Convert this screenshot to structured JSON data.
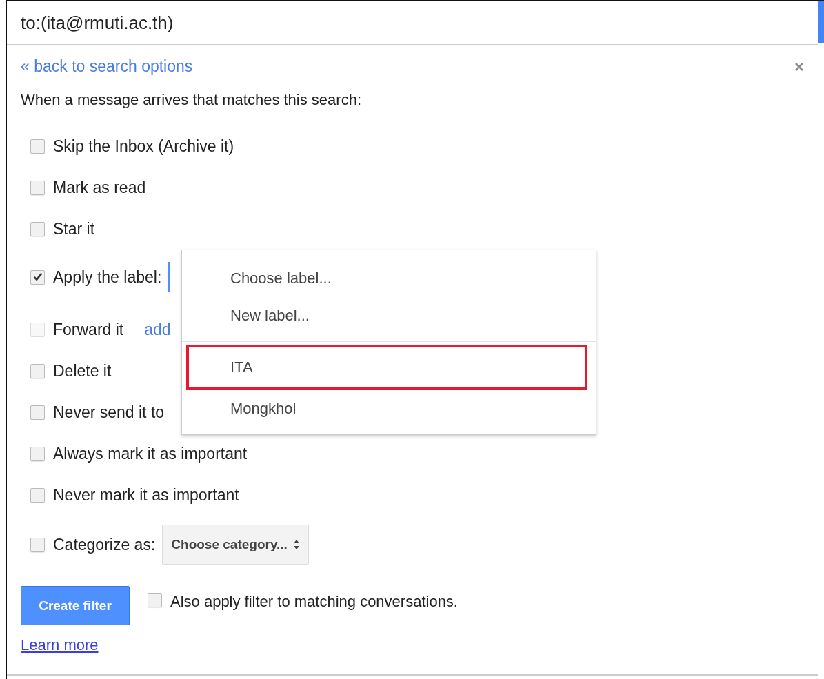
{
  "search": {
    "query": "to:(ita@rmuti.ac.th)"
  },
  "filter_panel": {
    "back_link": "« back to search options",
    "intro": "When a message arrives that matches this search:",
    "options": [
      {
        "kind": "plain",
        "label": "Skip the Inbox (Archive it)",
        "checked": false,
        "disabled": false
      },
      {
        "kind": "plain",
        "label": "Mark as read",
        "checked": false,
        "disabled": false
      },
      {
        "kind": "plain",
        "label": "Star it",
        "checked": false,
        "disabled": false
      },
      {
        "kind": "label",
        "label": "Apply the label:",
        "checked": true,
        "disabled": false
      },
      {
        "kind": "forward",
        "label": "Forward it",
        "checked": false,
        "disabled": true,
        "link": "add"
      },
      {
        "kind": "plain",
        "label": "Delete it",
        "checked": false,
        "disabled": false
      },
      {
        "kind": "plain",
        "label": "Never send it to",
        "checked": false,
        "disabled": false
      },
      {
        "kind": "plain",
        "label": "Always mark it as important",
        "checked": false,
        "disabled": false
      },
      {
        "kind": "plain",
        "label": "Never mark it as important",
        "checked": false,
        "disabled": false
      },
      {
        "kind": "category",
        "label": "Categorize as:",
        "checked": false,
        "disabled": false,
        "select": "Choose category..."
      }
    ],
    "create_button": "Create filter",
    "also_apply": {
      "label": "Also apply filter to matching conversations.",
      "checked": false
    },
    "learn_more": "Learn more"
  },
  "label_menu": {
    "groups": [
      [
        {
          "label": "Choose label...",
          "highlighted": false
        },
        {
          "label": "New label...",
          "highlighted": false
        }
      ],
      [
        {
          "label": "ITA",
          "highlighted": true
        },
        {
          "label": "Mongkhol",
          "highlighted": false
        }
      ]
    ]
  }
}
